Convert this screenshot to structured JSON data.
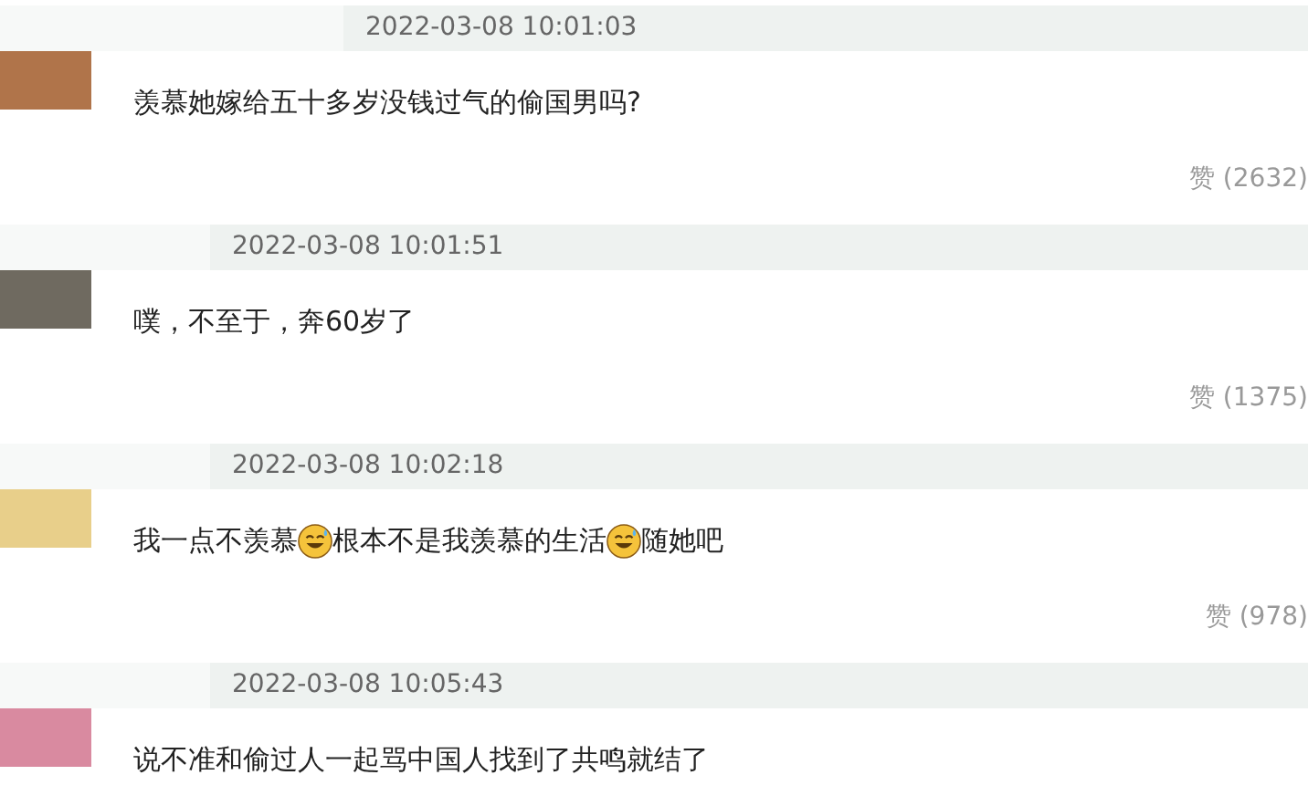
{
  "comments": [
    {
      "time": "2022-03-08 10:01:03",
      "parts": [
        {
          "kind": "text",
          "text": "羡慕她嫁给五十多岁没钱过气的偷国男吗?"
        }
      ],
      "likes": "赞 (2632)"
    },
    {
      "time": "2022-03-08 10:01:51",
      "parts": [
        {
          "kind": "text",
          "text": "噗，不至于，奔60岁了"
        }
      ],
      "likes": "赞 (1375)"
    },
    {
      "time": "2022-03-08 10:02:18",
      "parts": [
        {
          "kind": "text",
          "text": "我一点不羡慕"
        },
        {
          "kind": "emoji"
        },
        {
          "kind": "text",
          "text": "根本不是我羡慕的生活"
        },
        {
          "kind": "emoji"
        },
        {
          "kind": "text",
          "text": "随她吧"
        }
      ],
      "likes": "赞 (978)"
    },
    {
      "time": "2022-03-08 10:05:43",
      "parts": [
        {
          "kind": "text",
          "text": "说不准和偷过人一起骂中国人找到了共鸣就结了"
        }
      ]
    }
  ]
}
